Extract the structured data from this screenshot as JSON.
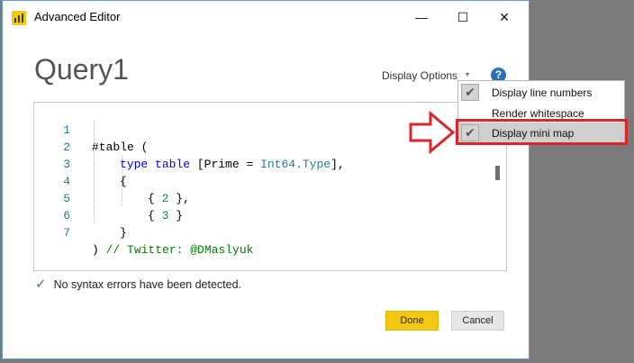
{
  "window": {
    "title": "Advanced Editor",
    "minimize": "—",
    "maximize": "☐",
    "close": "✕"
  },
  "query_title": "Query1",
  "toolbar": {
    "display_options": "Display Options",
    "caret": "▾",
    "help": "?"
  },
  "editor": {
    "lines": [
      {
        "num": "1"
      },
      {
        "num": "2"
      },
      {
        "num": "3"
      },
      {
        "num": "4"
      },
      {
        "num": "5"
      },
      {
        "num": "6"
      },
      {
        "num": "7"
      }
    ],
    "code": {
      "l1": "#table (",
      "l2_kw1": "type",
      "l2_kw2": "table",
      "l2_a": " [Prime = ",
      "l2_ty": "Int64.Type",
      "l2_b": "],",
      "l3": "{",
      "l4_a": "{ ",
      "l4_num": "2",
      "l4_b": " },",
      "l5_a": "{ ",
      "l5_num": "3",
      "l5_b": " }",
      "l6": "}",
      "l7_a": ") ",
      "l7_comment": "// Twitter: @DMaslyuk"
    }
  },
  "status": {
    "icon": "✓",
    "text": "No syntax errors have been detected."
  },
  "buttons": {
    "done": "Done",
    "cancel": "Cancel"
  },
  "menu": {
    "items": [
      {
        "label": "Display line numbers",
        "checked": true,
        "check": "✔"
      },
      {
        "label": "Render whitespace",
        "checked": false
      },
      {
        "label": "Display mini map",
        "checked": true,
        "check": "✔"
      }
    ]
  },
  "colors": {
    "accent_yellow": "#f2c811",
    "highlight_red": "#d8262b",
    "help_blue": "#2f6fb6"
  }
}
